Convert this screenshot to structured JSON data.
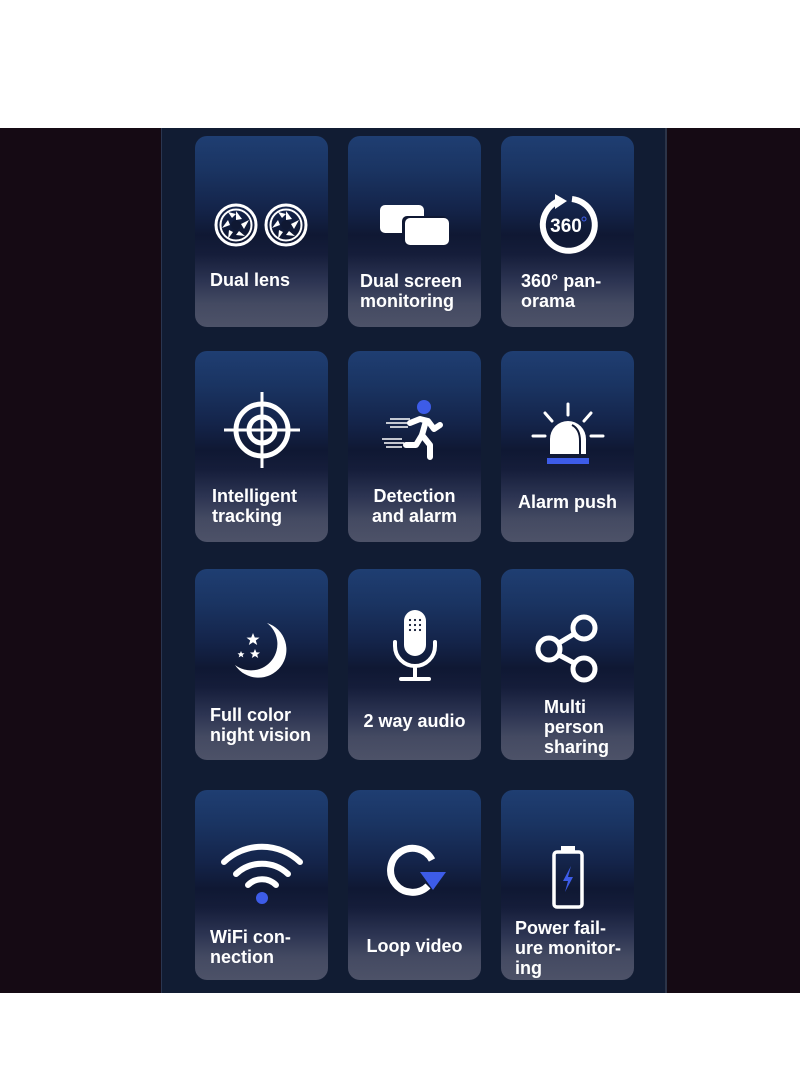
{
  "colors": {
    "accent_blue": "#3d5ce8",
    "icon_white": "#ffffff"
  },
  "features": [
    {
      "label": "Dual lens",
      "icon": "dual-lens-icon"
    },
    {
      "label": "Dual screen\nmonitoring",
      "icon": "dual-screen-icon"
    },
    {
      "label": "360° pan-\norama",
      "icon": "panorama-360-icon",
      "icon_text": "360"
    },
    {
      "label": "Intelligent\ntracking",
      "icon": "crosshair-target-icon"
    },
    {
      "label": "Detection\nand alarm",
      "icon": "running-person-icon"
    },
    {
      "label": "Alarm push",
      "icon": "alarm-siren-icon"
    },
    {
      "label": "Full color\nnight vision",
      "icon": "moon-stars-icon"
    },
    {
      "label": "2 way audio",
      "icon": "microphone-icon"
    },
    {
      "label": "Multi\nperson\nsharing",
      "icon": "share-nodes-icon"
    },
    {
      "label": "WiFi con-\nnection",
      "icon": "wifi-icon"
    },
    {
      "label": "Loop video",
      "icon": "loop-arrow-icon"
    },
    {
      "label": "Power fail-\nure monitor-\ning",
      "icon": "battery-charging-icon"
    }
  ]
}
